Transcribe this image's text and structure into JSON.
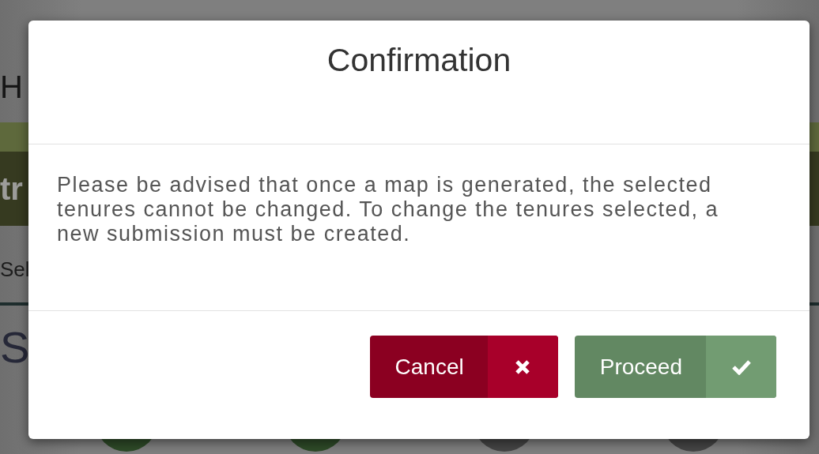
{
  "background": {
    "heading": "H",
    "banner_text": "tr",
    "label": "Sel",
    "section_heading": "S",
    "steps": [
      {
        "color": "#2e4a28"
      },
      {
        "color": "#2e4a28"
      },
      {
        "color": "#454545"
      },
      {
        "color": "#454545"
      }
    ]
  },
  "dialog": {
    "title": "Confirmation",
    "message": "Please be advised that once a map is generated, the selected tenures cannot be changed. To change the tenures selected, a new submission must be created.",
    "buttons": [
      {
        "label": "Cancel",
        "kind": "cancel"
      },
      {
        "label": "Proceed",
        "kind": "proceed"
      }
    ]
  }
}
